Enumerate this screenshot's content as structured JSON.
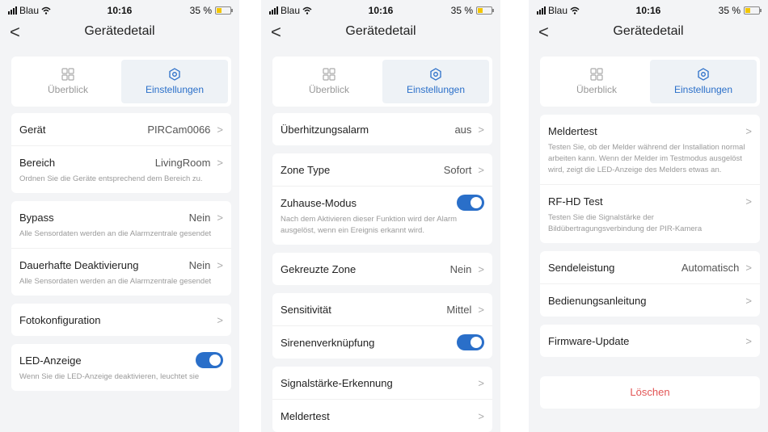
{
  "status": {
    "carrier": "Blau",
    "time": "10:16",
    "battery": "35 %",
    "battery_level": 0.35
  },
  "nav": {
    "back": "<",
    "title": "Gerätedetail"
  },
  "tabs": {
    "overview": "Überblick",
    "settings": "Einstellungen"
  },
  "chevron": ">",
  "screen1": {
    "geraet": {
      "label": "Gerät",
      "value": "PIRCam0066"
    },
    "bereich": {
      "label": "Bereich",
      "value": "LivingRoom",
      "desc": "Ordnen Sie die Geräte entsprechend dem Bereich zu."
    },
    "bypass": {
      "label": "Bypass",
      "value": "Nein",
      "desc": "Alle Sensordaten werden an die Alarmzentrale gesendet"
    },
    "dauerhaft": {
      "label": "Dauerhafte Deaktivierung",
      "value": "Nein",
      "desc": "Alle Sensordaten werden an die Alarmzentrale gesendet"
    },
    "foto": {
      "label": "Fotokonfiguration"
    },
    "led": {
      "label": "LED-Anzeige",
      "on": true,
      "desc": "Wenn Sie die LED-Anzeige deaktivieren, leuchtet sie"
    }
  },
  "screen2": {
    "ueberhitzung": {
      "label": "Überhitzungsalarm",
      "value": "aus"
    },
    "zone_type": {
      "label": "Zone Type",
      "value": "Sofort"
    },
    "zuhause": {
      "label": "Zuhause-Modus",
      "on": true,
      "desc": "Nach dem Aktivieren dieser Funktion wird der Alarm ausgelöst, wenn ein Ereignis erkannt wird."
    },
    "gekreuzte": {
      "label": "Gekreuzte Zone",
      "value": "Nein"
    },
    "sensitivitaet": {
      "label": "Sensitivität",
      "value": "Mittel"
    },
    "sirene": {
      "label": "Sirenenverknüpfung",
      "on": true
    },
    "signal": {
      "label": "Signalstärke-Erkennung"
    },
    "meldertest": {
      "label": "Meldertest"
    }
  },
  "screen3": {
    "meldertest": {
      "label": "Meldertest",
      "desc": "Testen Sie, ob der Melder während der Installation normal arbeiten kann. Wenn der Melder im Testmodus ausgelöst wird, zeigt die LED-Anzeige des Melders etwas an."
    },
    "rfhd": {
      "label": "RF-HD Test",
      "desc": "Testen Sie die Signalstärke der Bildübertragungsverbindung der PIR-Kamera"
    },
    "sende": {
      "label": "Sendeleistung",
      "value": "Automatisch"
    },
    "anleitung": {
      "label": "Bedienungsanleitung"
    },
    "firmware": {
      "label": "Firmware-Update"
    },
    "loeschen": {
      "label": "Löschen"
    }
  },
  "colors": {
    "accent": "#2a6fc9",
    "danger": "#e25555",
    "background": "#f3f4f6"
  },
  "icons": [
    "signal-icon",
    "wifi-icon",
    "battery-icon",
    "back-icon",
    "grid-icon",
    "gear-icon",
    "chevron-right-icon",
    "toggle"
  ]
}
